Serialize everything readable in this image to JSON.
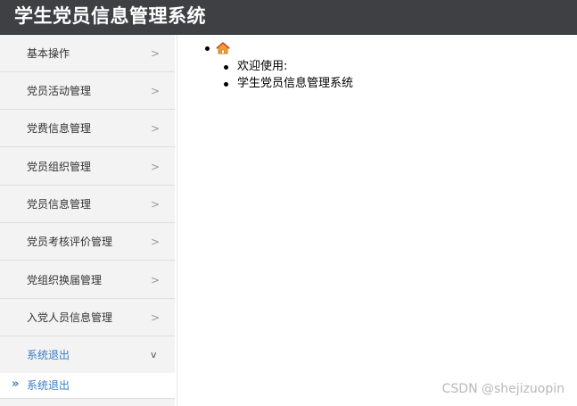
{
  "header": {
    "title": "学生党员信息管理系统"
  },
  "sidebar": {
    "items": [
      {
        "label": "基本操作",
        "chevron": ">"
      },
      {
        "label": "党员活动管理",
        "chevron": ">"
      },
      {
        "label": "党费信息管理",
        "chevron": ">"
      },
      {
        "label": "党员组织管理",
        "chevron": ">"
      },
      {
        "label": "党员信息管理",
        "chevron": ">"
      },
      {
        "label": "党员考核评价管理",
        "chevron": ">"
      },
      {
        "label": "党组织换届管理",
        "chevron": ">"
      },
      {
        "label": "入党人员信息管理",
        "chevron": ">"
      },
      {
        "label": "系统退出",
        "chevron": "v",
        "expanded": true
      }
    ],
    "submenu": {
      "arrow": "»",
      "label": "系统退出"
    }
  },
  "main": {
    "home_icon": "home-icon",
    "welcome_lines": [
      "欢迎使用:",
      "学生党员信息管理系统"
    ]
  },
  "watermark": "CSDN @shejizuopin",
  "colors": {
    "header_bg": "#3e4044",
    "sidebar_bg": "#f3f3f3",
    "accent": "#3c7dbf"
  }
}
